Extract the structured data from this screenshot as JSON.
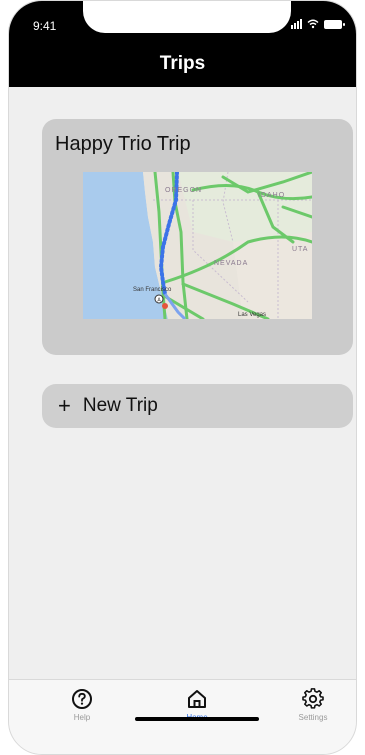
{
  "status_bar": {
    "time": "9:41"
  },
  "header": {
    "title": "Trips"
  },
  "trip_card": {
    "name": "Happy Trio Trip",
    "map_labels": [
      "OREGON",
      "IDAHO",
      "NEVADA",
      "UTA",
      "San Francisco",
      "Las Vegas"
    ]
  },
  "new_trip": {
    "plus": "+",
    "label": "New Trip"
  },
  "tabs": [
    {
      "label": "Help",
      "icon": "help-icon"
    },
    {
      "label": "Home",
      "icon": "home-icon"
    },
    {
      "label": "Settings",
      "icon": "gear-icon"
    }
  ],
  "colors": {
    "header_bg": "#000000",
    "active_tab": "#2f6fe4",
    "card_bg": "#cbcbcb",
    "route": "#3b73e8"
  }
}
